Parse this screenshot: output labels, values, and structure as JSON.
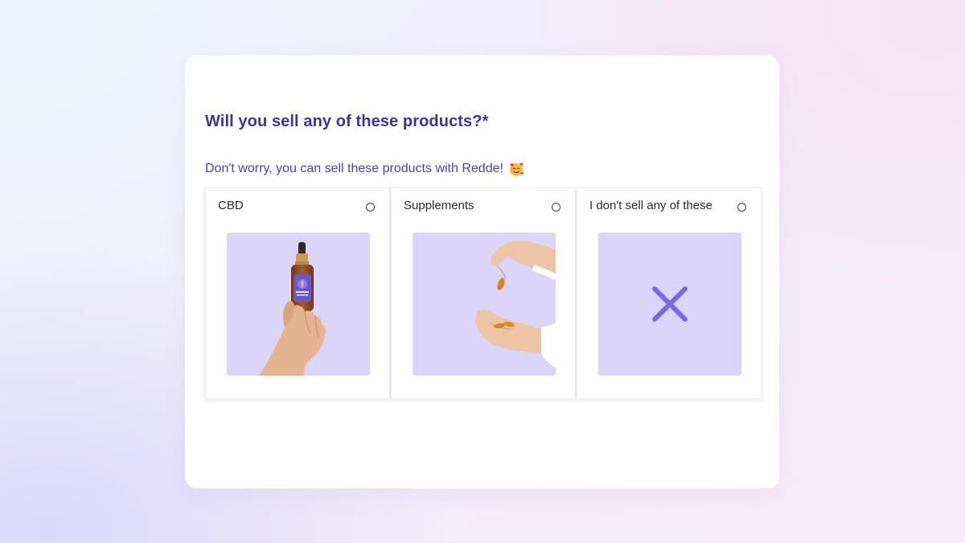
{
  "form": {
    "question": "Will you sell any of these products?*",
    "helper": "Don't worry, you can sell these products with Redde!",
    "helper_emoji": "smiling-face-with-hearts-icon"
  },
  "options": [
    {
      "label": "CBD",
      "selected": false,
      "image": "cbd-oil-bottle-in-hand"
    },
    {
      "label": "Supplements",
      "selected": false,
      "image": "supplement-capsules-in-hands"
    },
    {
      "label": "I don't sell any of these",
      "selected": false,
      "image": "close-x-icon"
    }
  ],
  "colors": {
    "primary": "#3d3593",
    "image_bg": "#dcd5fb",
    "x_icon": "#7b6ae0"
  }
}
